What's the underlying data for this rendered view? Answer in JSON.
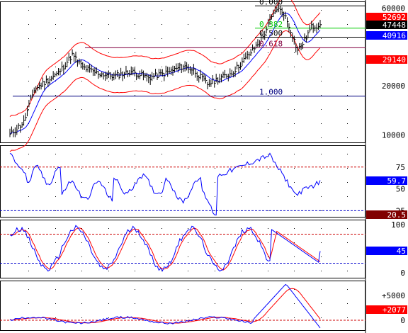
{
  "colors": {
    "background": "#ffffff",
    "frame": "#000000",
    "grid": "#000000",
    "price": "#000000",
    "band_upper": "#ff0000",
    "band_lower": "#ff0000",
    "moving_average": "#0000ff",
    "oscillator": "#0000ff",
    "signal": "#ff0000",
    "ref_line_red": "#cc0000",
    "ref_line_blue": "#0000cc",
    "fib_green": "#00cc00",
    "fib_purple": "#800040",
    "fib_blue": "#000080",
    "badge_red": "#ff0000",
    "badge_blue": "#0000ff",
    "badge_black": "#000000",
    "badge_maroon": "#800000"
  },
  "price_panel": {
    "scale": "log",
    "ylim": [
      9000,
      66000
    ],
    "y_ticks": [
      {
        "value": 60000,
        "label": "60000"
      },
      {
        "value": 50000,
        "label": "50000"
      },
      {
        "value": 40000,
        "label": "40000"
      },
      {
        "value": 20000,
        "label": "20000"
      },
      {
        "value": 10000,
        "label": "10000"
      }
    ],
    "badges": [
      {
        "value": 52692,
        "label": "52692",
        "color": "#ff0000"
      },
      {
        "value": 47448,
        "label": "47448",
        "color": "#000000"
      },
      {
        "value": 40916,
        "label": "40916",
        "color": "#0000ff"
      },
      {
        "value": 29140,
        "label": "29140",
        "color": "#ff0000"
      }
    ],
    "fib_levels": [
      {
        "label": "0.000",
        "value": 62000,
        "color": "#000000"
      },
      {
        "label": "0.382",
        "value": 45200,
        "color": "#00cc00"
      },
      {
        "label": "0.500",
        "value": 39800,
        "color": "#000000"
      },
      {
        "label": "0.618",
        "value": 34300,
        "color": "#800040"
      },
      {
        "label": "1.000",
        "value": 17300,
        "color": "#000080"
      }
    ],
    "fib_start_x": 0.655
  },
  "rsi_panel": {
    "ylim": [
      18,
      100
    ],
    "y_ticks": [
      {
        "value": 75,
        "label": "75"
      },
      {
        "value": 50,
        "label": "50"
      },
      {
        "value": 25,
        "label": "25"
      }
    ],
    "ref_lines": [
      {
        "value": 75,
        "color": "#cc0000"
      },
      {
        "value": 25,
        "color": "#0000cc"
      }
    ],
    "badges": [
      {
        "value": 59.7,
        "label": "59.7",
        "color": "#0000ff"
      },
      {
        "value": 20.5,
        "label": "20.5",
        "color": "#800000"
      }
    ]
  },
  "stoch_panel": {
    "ylim": [
      -10,
      110
    ],
    "y_ticks": [
      {
        "value": 100,
        "label": "100"
      },
      {
        "value": 0,
        "label": "0"
      }
    ],
    "ref_lines": [
      {
        "value": 80,
        "color": "#cc0000"
      },
      {
        "value": 20,
        "color": "#0000cc"
      }
    ],
    "badges": [
      {
        "value": 45,
        "label": "45",
        "color": "#0000ff"
      }
    ]
  },
  "macd_panel": {
    "ylim": [
      -2000,
      8000
    ],
    "y_ticks": [
      {
        "value": 5000,
        "label": "+5000"
      },
      {
        "value": 0,
        "label": "0"
      }
    ],
    "badges": [
      {
        "value": 2077,
        "label": "+2077",
        "color": "#ff0000"
      }
    ]
  }
}
